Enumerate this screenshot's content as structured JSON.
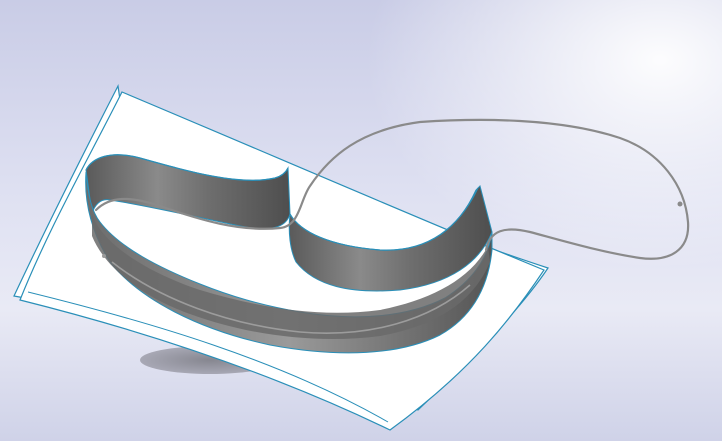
{
  "viewport": {
    "background_top": "#c9cce6",
    "background_bottom": "#cfd2e8",
    "sheet_fill": "#ffffff",
    "sheet_edge_color": "#2a8fb8",
    "solid_color": "#7a7a7a",
    "path_color": "#8a8a8a"
  },
  "scene": {
    "objects": [
      {
        "name": "base-surface-sheet",
        "type": "surface"
      },
      {
        "name": "swept-wall-solid",
        "type": "solid"
      },
      {
        "name": "sweep-path-curve",
        "type": "curve"
      }
    ]
  }
}
